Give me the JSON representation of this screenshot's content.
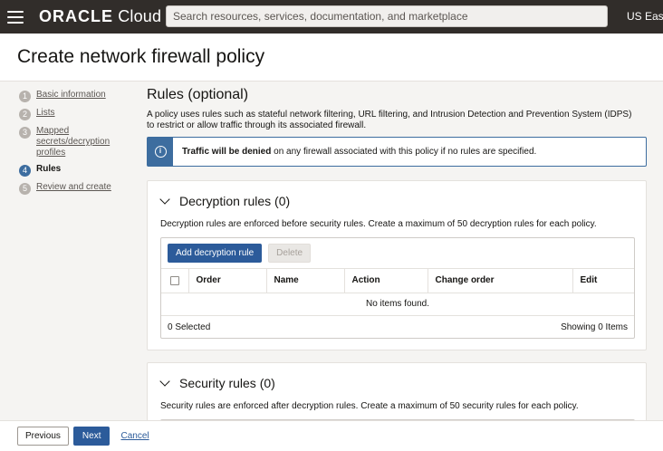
{
  "topbar": {
    "logo_brand": "ORACLE",
    "logo_suffix": " Cloud",
    "search_placeholder": "Search resources, services, documentation, and marketplace",
    "region": "US East"
  },
  "header": {
    "title": "Create network firewall policy"
  },
  "steps": [
    {
      "num": "1",
      "label": "Basic information",
      "state": "link"
    },
    {
      "num": "2",
      "label": "Lists",
      "state": "link"
    },
    {
      "num": "3",
      "label": "Mapped secrets/decryption profiles",
      "state": "link"
    },
    {
      "num": "4",
      "label": "Rules",
      "state": "active"
    },
    {
      "num": "5",
      "label": "Review and create",
      "state": "link"
    }
  ],
  "main": {
    "title": "Rules (optional)",
    "description": "A policy uses rules such as stateful network filtering, URL filtering, and Intrusion Detection and Prevention System (IDPS) to restrict or allow traffic through its associated firewall.",
    "info": {
      "icon": "info-icon",
      "bold": "Traffic will be denied",
      "rest": " on any firewall associated with this policy if no rules are specified."
    }
  },
  "decryption": {
    "title": "Decryption rules (0)",
    "description": "Decryption rules are enforced before security rules. Create a maximum of 50 decryption rules for each policy.",
    "add_label": "Add decryption rule",
    "delete_label": "Delete",
    "columns": [
      "Order",
      "Name",
      "Action",
      "Change order",
      "Edit"
    ],
    "empty": "No items found.",
    "selected": "0 Selected",
    "showing": "Showing 0 Items"
  },
  "security": {
    "title": "Security rules (0)",
    "description": "Security rules are enforced after decryption rules. Create a maximum of 50 security rules for each policy."
  },
  "footer": {
    "previous": "Previous",
    "next": "Next",
    "cancel": "Cancel"
  },
  "colors": {
    "topbar": "#312d2a",
    "primary": "#2c5b9a",
    "info": "#3d6d9f"
  }
}
